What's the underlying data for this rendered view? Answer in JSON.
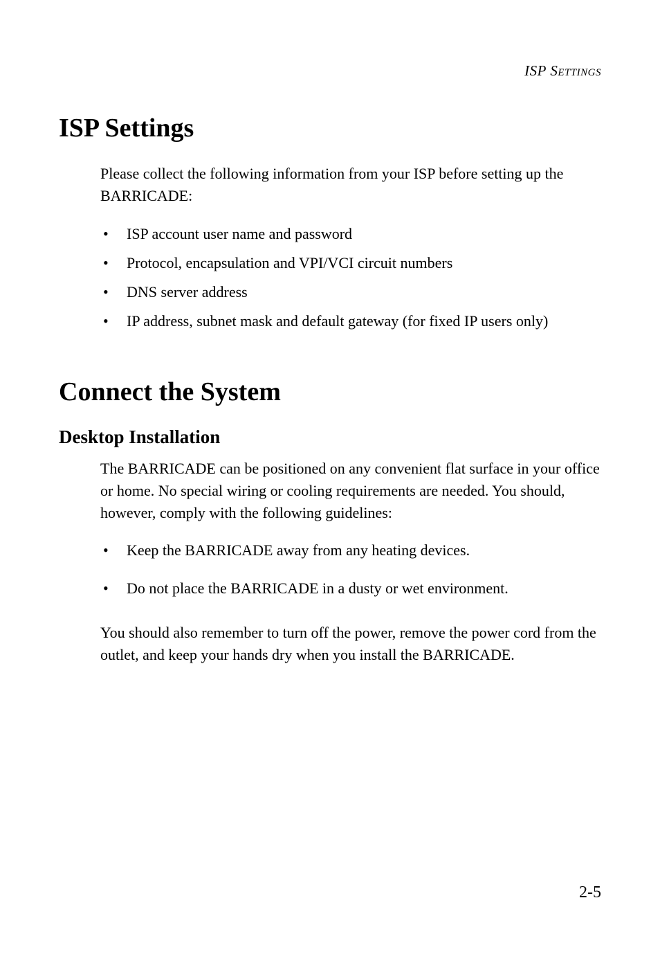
{
  "running_header": "ISP Settings",
  "section1": {
    "heading": "ISP Settings",
    "intro": "Please collect the following information from your ISP before setting up the BARRICADE:",
    "bullets": [
      "ISP account user name and password",
      "Protocol, encapsulation and VPI/VCI circuit numbers",
      "DNS server address",
      "IP address, subnet mask and default gateway (for fixed IP users only)"
    ]
  },
  "section2": {
    "heading": "Connect the System",
    "subsection": {
      "heading": "Desktop Installation",
      "intro": "The BARRICADE can be positioned on any convenient flat surface in your office or home. No special wiring or cooling requirements are needed. You should, however, comply with the following guidelines:",
      "bullets": [
        "Keep the BARRICADE away from any heating devices.",
        "Do not place the BARRICADE in a dusty or wet environment."
      ],
      "closing": "You should also remember to turn off the power, remove the power cord from the outlet, and keep your hands dry when you install the BARRICADE."
    }
  },
  "page_number": "2-5",
  "bullet_marker": "•"
}
